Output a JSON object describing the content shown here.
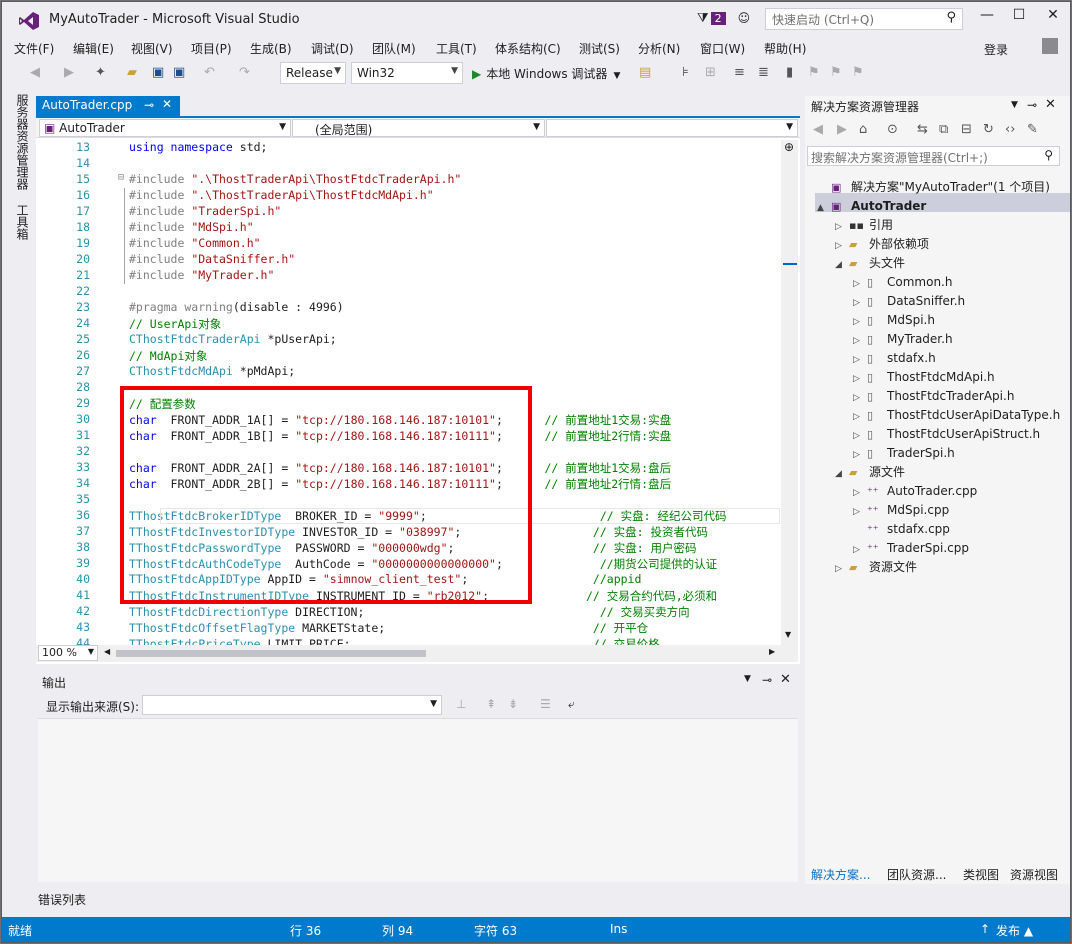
{
  "window": {
    "title": "MyAutoTrader - Microsoft Visual Studio",
    "notifications": "2",
    "quick_launch_placeholder": "快速启动 (Ctrl+Q)",
    "login": "登录"
  },
  "menu": [
    "文件(F)",
    "编辑(E)",
    "视图(V)",
    "项目(P)",
    "生成(B)",
    "调试(D)",
    "团队(M)",
    "工具(T)",
    "体系结构(C)",
    "测试(S)",
    "分析(N)",
    "窗口(W)",
    "帮助(H)"
  ],
  "toolbar": {
    "config": "Release",
    "platform": "Win32",
    "run_label": "本地 Windows 调试器"
  },
  "left_tabs": [
    "服务器资源管理器",
    "工具箱"
  ],
  "editor": {
    "tab_title": "AutoTrader.cpp",
    "nav_project": "AutoTrader",
    "nav_scope": "(全局范围)",
    "nav_member": "",
    "zoom": "100 %",
    "lines": [
      {
        "n": "13",
        "parts": [
          [
            "k",
            "using namespace"
          ],
          [
            "n",
            " std;"
          ]
        ]
      },
      {
        "n": "14",
        "parts": []
      },
      {
        "n": "15",
        "fold": true,
        "parts": [
          [
            "pp",
            "#include "
          ],
          [
            "s",
            "\".\\ThostTraderApi\\ThostFtdcTraderApi.h\""
          ]
        ]
      },
      {
        "n": "16",
        "parts": [
          [
            "pp",
            "#include "
          ],
          [
            "s",
            "\".\\ThostTraderApi\\ThostFtdcMdApi.h\""
          ]
        ]
      },
      {
        "n": "17",
        "parts": [
          [
            "pp",
            "#include "
          ],
          [
            "s",
            "\"TraderSpi.h\""
          ]
        ]
      },
      {
        "n": "18",
        "parts": [
          [
            "pp",
            "#include "
          ],
          [
            "s",
            "\"MdSpi.h\""
          ]
        ]
      },
      {
        "n": "19",
        "parts": [
          [
            "pp",
            "#include "
          ],
          [
            "s",
            "\"Common.h\""
          ]
        ]
      },
      {
        "n": "20",
        "parts": [
          [
            "pp",
            "#include "
          ],
          [
            "s",
            "\"DataSniffer.h\""
          ]
        ]
      },
      {
        "n": "21",
        "parts": [
          [
            "pp",
            "#include "
          ],
          [
            "s",
            "\"MyTrader.h\""
          ]
        ]
      },
      {
        "n": "22",
        "parts": []
      },
      {
        "n": "23",
        "parts": [
          [
            "pp",
            "#pragma warning"
          ],
          [
            "n",
            "(disable : 4996)"
          ]
        ]
      },
      {
        "n": "24",
        "parts": [
          [
            "c",
            "// UserApi对象"
          ]
        ]
      },
      {
        "n": "25",
        "parts": [
          [
            "ty",
            "CThostFtdcTraderApi"
          ],
          [
            "n",
            " *pUserApi;"
          ]
        ]
      },
      {
        "n": "26",
        "parts": [
          [
            "c",
            "// MdApi对象"
          ]
        ]
      },
      {
        "n": "27",
        "parts": [
          [
            "ty",
            "CThostFtdcMdApi"
          ],
          [
            "n",
            " *pMdApi;"
          ]
        ]
      },
      {
        "n": "28",
        "parts": []
      },
      {
        "n": "29",
        "parts": [
          [
            "c",
            "// 配置参数"
          ]
        ]
      },
      {
        "n": "30",
        "parts": [
          [
            "k",
            "char"
          ],
          [
            "n",
            "  FRONT_ADDR_1A[] = "
          ],
          [
            "s",
            "\"tcp://180.168.146.187:10101\""
          ],
          [
            "n",
            ";      "
          ],
          [
            "c",
            "// 前置地址1交易:实盘"
          ]
        ]
      },
      {
        "n": "31",
        "parts": [
          [
            "k",
            "char"
          ],
          [
            "n",
            "  FRONT_ADDR_1B[] = "
          ],
          [
            "s",
            "\"tcp://180.168.146.187:10111\""
          ],
          [
            "n",
            ";      "
          ],
          [
            "c",
            "// 前置地址2行情:实盘"
          ]
        ]
      },
      {
        "n": "32",
        "parts": []
      },
      {
        "n": "33",
        "parts": [
          [
            "k",
            "char"
          ],
          [
            "n",
            "  FRONT_ADDR_2A[] = "
          ],
          [
            "s",
            "\"tcp://180.168.146.187:10101\""
          ],
          [
            "n",
            ";      "
          ],
          [
            "c",
            "// 前置地址1交易:盘后"
          ]
        ]
      },
      {
        "n": "34",
        "parts": [
          [
            "k",
            "char"
          ],
          [
            "n",
            "  FRONT_ADDR_2B[] = "
          ],
          [
            "s",
            "\"tcp://180.168.146.187:10111\""
          ],
          [
            "n",
            ";      "
          ],
          [
            "c",
            "// 前置地址2行情:盘后"
          ]
        ]
      },
      {
        "n": "35",
        "parts": []
      },
      {
        "n": "36",
        "parts": [
          [
            "ty",
            "TThostFtdcBrokerIDType"
          ],
          [
            "n",
            "  BROKER_ID = "
          ],
          [
            "s",
            "\"9999\""
          ],
          [
            "n",
            ";                         "
          ],
          [
            "c",
            "// 实盘: 经纪公司代码"
          ]
        ]
      },
      {
        "n": "37",
        "parts": [
          [
            "ty",
            "TThostFtdcInvestorIDType"
          ],
          [
            "n",
            " INVESTOR_ID = "
          ],
          [
            "s",
            "\"038997\""
          ],
          [
            "n",
            ";                   "
          ],
          [
            "c",
            "// 实盘: 投资者代码"
          ]
        ]
      },
      {
        "n": "38",
        "parts": [
          [
            "ty",
            "TThostFtdcPasswordType"
          ],
          [
            "n",
            "  PASSWORD = "
          ],
          [
            "s",
            "\"000000wdg\""
          ],
          [
            "n",
            ";                    "
          ],
          [
            "c",
            "// 实盘: 用户密码"
          ]
        ]
      },
      {
        "n": "39",
        "parts": [
          [
            "ty",
            "TThostFtdcAuthCodeType"
          ],
          [
            "n",
            "  AuthCode = "
          ],
          [
            "s",
            "\"0000000000000000\""
          ],
          [
            "n",
            ";              "
          ],
          [
            "c",
            "//期货公司提供的认证"
          ]
        ]
      },
      {
        "n": "40",
        "parts": [
          [
            "ty",
            "TThostFtdcAppIDType"
          ],
          [
            "n",
            " AppID = "
          ],
          [
            "s",
            "\"simnow_client_test\""
          ],
          [
            "n",
            ";                  "
          ],
          [
            "c",
            "//appid"
          ]
        ]
      },
      {
        "n": "41",
        "parts": [
          [
            "ty",
            "TThostFtdcInstrumentIDType"
          ],
          [
            "n",
            " INSTRUMENT_ID = "
          ],
          [
            "s",
            "\"rb2012\""
          ],
          [
            "n",
            ";              "
          ],
          [
            "c",
            "// 交易合约代码,必须和"
          ]
        ]
      },
      {
        "n": "42",
        "parts": [
          [
            "ty",
            "TThostFtdcDirectionType"
          ],
          [
            "n",
            " DIRECTION;"
          ],
          [
            "n",
            "                                  "
          ],
          [
            "c",
            "// 交易买卖方向"
          ]
        ]
      },
      {
        "n": "43",
        "parts": [
          [
            "ty",
            "TThostFtdcOffsetFlagType"
          ],
          [
            "n",
            " MARKETState;"
          ],
          [
            "n",
            "                              "
          ],
          [
            "c",
            "// 开平仓"
          ]
        ]
      },
      {
        "n": "44",
        "parts": [
          [
            "ty",
            "TThostFtdcPriceType"
          ],
          [
            "n",
            " LIMIT_PRICE;"
          ],
          [
            "n",
            "                                   "
          ],
          [
            "c",
            "// 交易价格"
          ]
        ]
      }
    ]
  },
  "output": {
    "title": "输出",
    "source_label": "显示输出来源(S):",
    "source_value": ""
  },
  "error_tab": "错误列表",
  "solution": {
    "title": "解决方案资源管理器",
    "search_placeholder": "搜索解决方案资源管理器(Ctrl+;)",
    "tree": [
      {
        "label": "解决方案\"MyAutoTrader\"(1 个项目)",
        "level": 0,
        "icon": "solution-icon",
        "exp": ""
      },
      {
        "label": "AutoTrader",
        "level": 0,
        "icon": "project-icon",
        "exp": "▲",
        "bold": true,
        "selected": true
      },
      {
        "label": "引用",
        "level": 1,
        "icon": "references-icon",
        "exp": "▷"
      },
      {
        "label": "外部依赖项",
        "level": 1,
        "icon": "folder-icon",
        "exp": "▷"
      },
      {
        "label": "头文件",
        "level": 1,
        "icon": "folder-icon",
        "exp": "◢"
      },
      {
        "label": "Common.h",
        "level": 2,
        "icon": "header-file-icon",
        "exp": "▷"
      },
      {
        "label": "DataSniffer.h",
        "level": 2,
        "icon": "header-file-icon",
        "exp": "▷"
      },
      {
        "label": "MdSpi.h",
        "level": 2,
        "icon": "header-file-icon",
        "exp": "▷"
      },
      {
        "label": "MyTrader.h",
        "level": 2,
        "icon": "header-file-icon",
        "exp": "▷"
      },
      {
        "label": "stdafx.h",
        "level": 2,
        "icon": "header-file-icon",
        "exp": "▷"
      },
      {
        "label": "ThostFtdcMdApi.h",
        "level": 2,
        "icon": "header-file-icon",
        "exp": "▷"
      },
      {
        "label": "ThostFtdcTraderApi.h",
        "level": 2,
        "icon": "header-file-icon",
        "exp": "▷"
      },
      {
        "label": "ThostFtdcUserApiDataType.h",
        "level": 2,
        "icon": "header-file-icon",
        "exp": "▷"
      },
      {
        "label": "ThostFtdcUserApiStruct.h",
        "level": 2,
        "icon": "header-file-icon",
        "exp": "▷"
      },
      {
        "label": "TraderSpi.h",
        "level": 2,
        "icon": "header-file-icon",
        "exp": "▷"
      },
      {
        "label": "源文件",
        "level": 1,
        "icon": "folder-icon",
        "exp": "◢"
      },
      {
        "label": "AutoTrader.cpp",
        "level": 2,
        "icon": "cpp-file-icon",
        "exp": "▷"
      },
      {
        "label": "MdSpi.cpp",
        "level": 2,
        "icon": "cpp-file-icon",
        "exp": "▷"
      },
      {
        "label": "stdafx.cpp",
        "level": 2,
        "icon": "cpp-file-icon",
        "exp": ""
      },
      {
        "label": "TraderSpi.cpp",
        "level": 2,
        "icon": "cpp-file-icon",
        "exp": "▷"
      },
      {
        "label": "资源文件",
        "level": 1,
        "icon": "folder-icon",
        "exp": "▷"
      }
    ],
    "tabs": [
      "解决方案...",
      "团队资源...",
      "类视图",
      "资源视图"
    ]
  },
  "status": {
    "ready": "就绪",
    "line": "行 36",
    "col": "列 94",
    "char": "字符 63",
    "mode": "Ins",
    "publish": "发布"
  },
  "colors": {
    "accent": "#007acc",
    "highlight": "#e00000",
    "vs_purple": "#68217a"
  }
}
